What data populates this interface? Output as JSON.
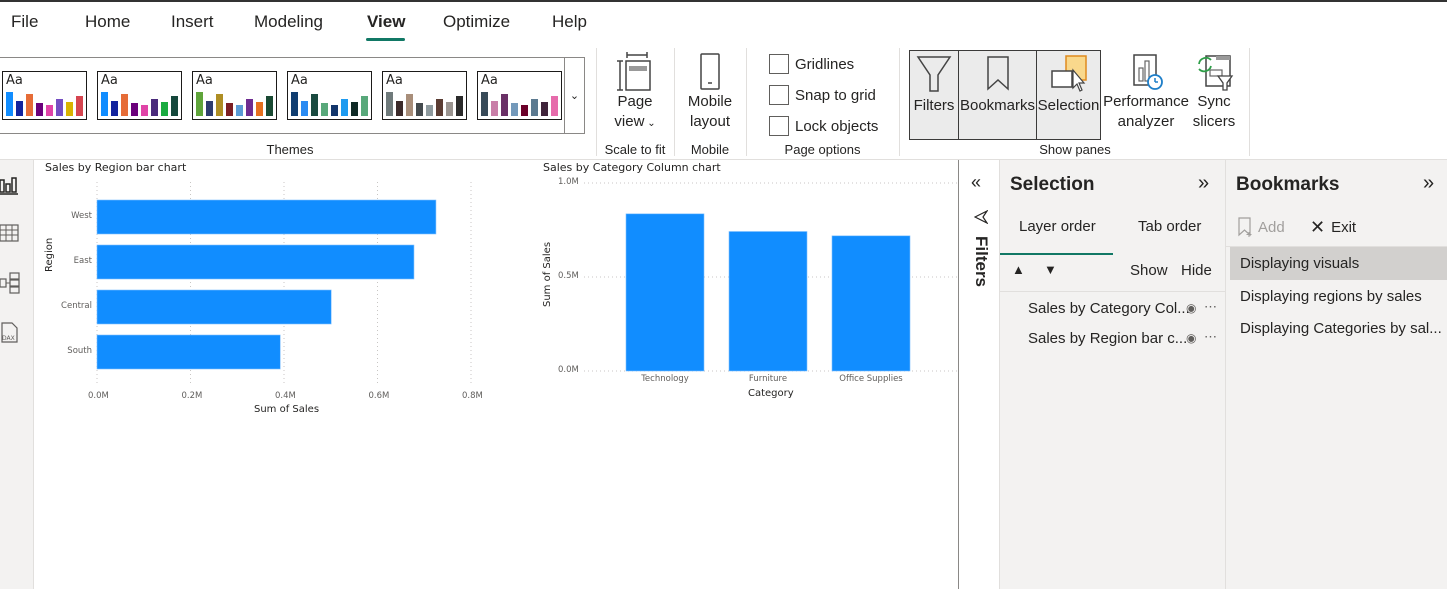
{
  "menu": {
    "items": [
      {
        "label": "File"
      },
      {
        "label": "Home"
      },
      {
        "label": "Insert"
      },
      {
        "label": "Modeling"
      },
      {
        "label": "View",
        "active": true
      },
      {
        "label": "Optimize"
      },
      {
        "label": "Help"
      }
    ]
  },
  "ribbon": {
    "themes": {
      "group_label": "Themes",
      "sample_text": "Aa",
      "palettes": [
        [
          "#118DFF",
          "#12239E",
          "#E66C37",
          "#6B007B",
          "#E044A7",
          "#744EC2",
          "#D9B300",
          "#D64550"
        ],
        [
          "#118DFF",
          "#12239E",
          "#E66C37",
          "#6B007B",
          "#E044A7",
          "#4A2A7B",
          "#1AAB40",
          "#15483C"
        ],
        [
          "#5FA43A",
          "#2D3B6E",
          "#AE8E24",
          "#7B1E23",
          "#5B9BD5",
          "#6E2C91",
          "#E6701F",
          "#1A4A33"
        ],
        [
          "#0F3D70",
          "#2A8BF2",
          "#1A4A40",
          "#58A87A",
          "#12356B",
          "#1E9BF0",
          "#0F2A26",
          "#58A87A"
        ],
        [
          "#6F7A7B",
          "#3B2A2A",
          "#A88E7A",
          "#444A4D",
          "#8E9A9E",
          "#5A3C33",
          "#9A9490",
          "#2B2B2B"
        ],
        [
          "#374A58",
          "#C97FA8",
          "#6A3066",
          "#7399BA",
          "#6B0029",
          "#5C7A90",
          "#40243B",
          "#E66BAB"
        ]
      ]
    },
    "scale_to_fit": {
      "button_line1": "Page",
      "button_line2": "view",
      "group_label": "Scale to fit"
    },
    "mobile": {
      "button_line1": "Mobile",
      "button_line2": "layout",
      "group_label": "Mobile"
    },
    "page_options": {
      "group_label": "Page options",
      "checkboxes": [
        {
          "label": "Gridlines",
          "checked": false
        },
        {
          "label": "Snap to grid",
          "checked": false
        },
        {
          "label": "Lock objects",
          "checked": false
        }
      ]
    },
    "show_panes": {
      "group_label": "Show panes",
      "filters": "Filters",
      "bookmarks": "Bookmarks",
      "selection": "Selection",
      "performance_line1": "Performance",
      "performance_line2": "analyzer",
      "sync_line1": "Sync",
      "sync_line2": "slicers"
    }
  },
  "colors": {
    "bar": "#118DFF",
    "accent": "#117865",
    "selection_highlight": "#F9D88C"
  },
  "chart_data": [
    {
      "type": "bar",
      "orientation": "horizontal",
      "title": "Sales by Region bar chart",
      "categories": [
        "West",
        "East",
        "Central",
        "South"
      ],
      "values": [
        0.725,
        0.678,
        0.501,
        0.392
      ],
      "value_unit": "M",
      "xlabel": "Sum of Sales",
      "ylabel": "Region",
      "xlim": [
        0,
        0.8
      ],
      "xticks": [
        "0.0M",
        "0.2M",
        "0.4M",
        "0.6M",
        "0.8M"
      ],
      "grid": true
    },
    {
      "type": "bar",
      "orientation": "vertical",
      "title": "Sales by Category Column chart",
      "categories": [
        "Technology",
        "Furniture",
        "Office Supplies"
      ],
      "values": [
        0.836,
        0.742,
        0.719
      ],
      "value_unit": "M",
      "xlabel": "Category",
      "ylabel": "Sum of Sales",
      "ylim": [
        0,
        1.0
      ],
      "yticks": [
        "0.0M",
        "0.5M",
        "1.0M"
      ],
      "grid": true
    }
  ],
  "filters_pane": {
    "label": "Filters"
  },
  "selection_pane": {
    "title": "Selection",
    "tabs": [
      {
        "label": "Layer order",
        "active": true
      },
      {
        "label": "Tab order"
      }
    ],
    "show_label": "Show",
    "hide_label": "Hide",
    "layers": [
      {
        "label": "Sales by Category Col..."
      },
      {
        "label": "Sales by Region bar c..."
      }
    ]
  },
  "bookmarks_pane": {
    "title": "Bookmarks",
    "add_label": "Add",
    "exit_label": "Exit",
    "items": [
      {
        "label": "Displaying visuals",
        "selected": true
      },
      {
        "label": "Displaying regions by sales"
      },
      {
        "label": "Displaying Categories by sal..."
      }
    ]
  }
}
